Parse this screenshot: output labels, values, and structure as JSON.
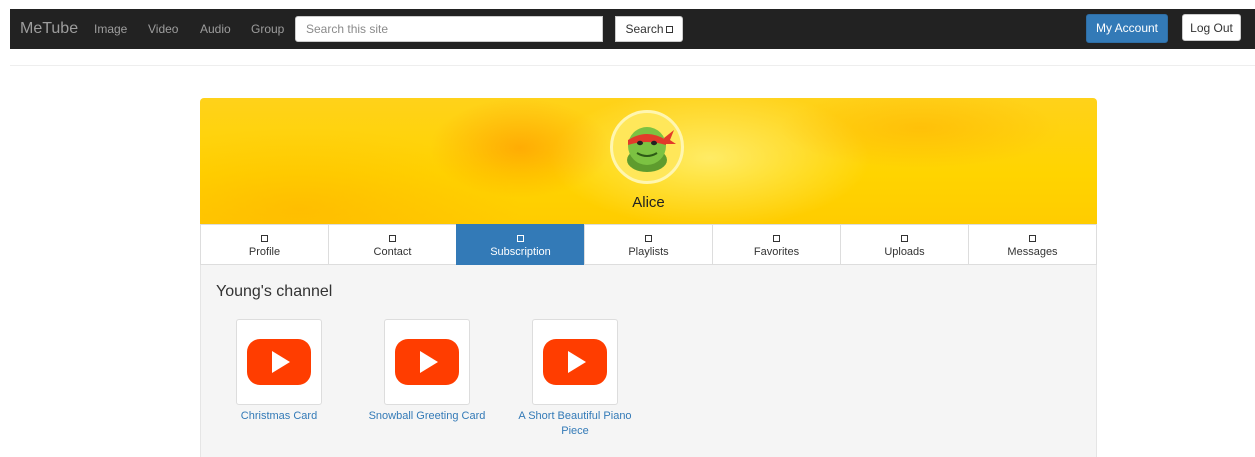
{
  "nav": {
    "brand": "MeTube",
    "links": [
      "Image",
      "Video",
      "Audio",
      "Group"
    ],
    "search_placeholder": "Search this site",
    "search_label": "Search",
    "account_label": "My Account",
    "logout_label": "Log Out"
  },
  "profile": {
    "name": "Alice",
    "tabs": [
      {
        "label": "Profile"
      },
      {
        "label": "Contact"
      },
      {
        "label": "Subscription",
        "active": true
      },
      {
        "label": "Playlists"
      },
      {
        "label": "Favorites"
      },
      {
        "label": "Uploads"
      },
      {
        "label": "Messages"
      }
    ]
  },
  "channel": {
    "title": "Young's channel",
    "videos": [
      {
        "title": "Christmas Card"
      },
      {
        "title": "Snowball Greeting Card"
      },
      {
        "title": "A Short Beautiful Piano Piece"
      }
    ]
  },
  "colors": {
    "navbar": "#222222",
    "accent": "#337ab7",
    "play_icon": "#ff3d00"
  }
}
